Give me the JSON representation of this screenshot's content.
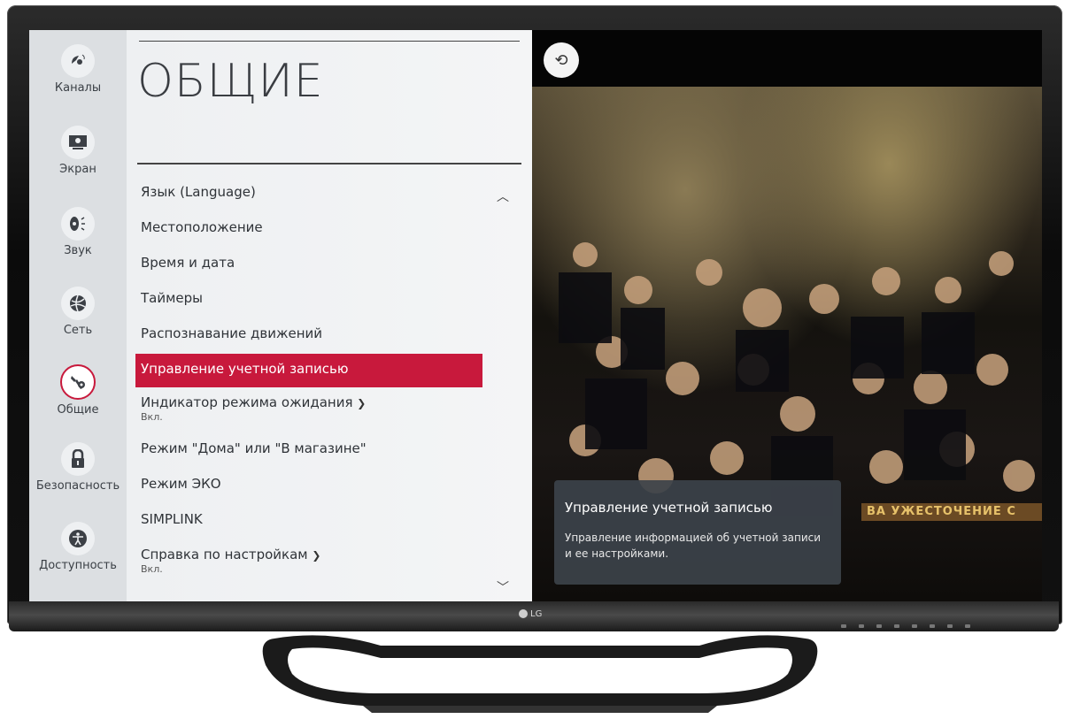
{
  "rail": {
    "items": [
      {
        "label": "Каналы",
        "icon": "satellite-dish-icon"
      },
      {
        "label": "Экран",
        "icon": "monitor-icon"
      },
      {
        "label": "Звук",
        "icon": "speaker-icon"
      },
      {
        "label": "Сеть",
        "icon": "globe-network-icon"
      },
      {
        "label": "Общие",
        "icon": "wrench-gear-icon",
        "active": true
      },
      {
        "label": "Безопасность",
        "icon": "lock-icon"
      },
      {
        "label": "Доступность",
        "icon": "accessibility-person-icon"
      }
    ]
  },
  "menu": {
    "title": "ОБЩИЕ",
    "items": [
      {
        "label": "Язык (Language)"
      },
      {
        "label": "Местоположение"
      },
      {
        "label": "Время и дата"
      },
      {
        "label": "Таймеры"
      },
      {
        "label": "Распознавание движений"
      },
      {
        "label": "Управление учетной записью",
        "selected": true
      },
      {
        "label": "Индикатор режима ожидания",
        "value": "Вкл."
      },
      {
        "label": "Режим \"Дома\" или \"В магазине\""
      },
      {
        "label": "Режим ЭКО"
      },
      {
        "label": "SIMPLINK"
      },
      {
        "label": "Справка по настройкам",
        "value": "Вкл."
      }
    ]
  },
  "info": {
    "title": "Управление учетной записью",
    "description": "Управление информацией об учетной записи и ее настройками."
  },
  "ticker": {
    "text": "ВА УЖЕСТОЧЕНИЕ С"
  },
  "brand": {
    "logo": "LG"
  },
  "colors": {
    "accent": "#c8193c",
    "rail_bg": "#dcdfe2",
    "panel_bg": "#eef0f2"
  }
}
